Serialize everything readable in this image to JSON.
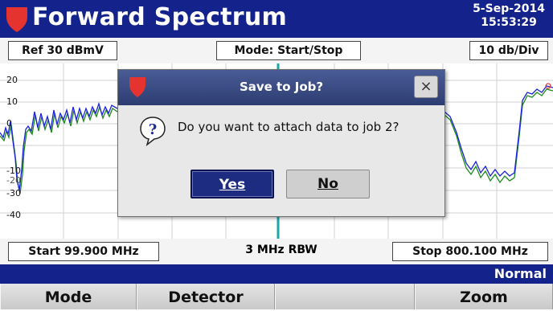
{
  "header": {
    "title": "Forward Spectrum",
    "date": "5-Sep-2014",
    "time": "15:53:29"
  },
  "top_info": {
    "ref": "Ref 30 dBmV",
    "mode": "Mode: Start/Stop",
    "scale": "10 db/Div"
  },
  "plot": {
    "y_ticks": [
      "20",
      "10",
      "0",
      "-10",
      "-20",
      "-30",
      "-40"
    ],
    "trace_colors": {
      "live": "#1a22d8",
      "reference": "#1a8a1a"
    }
  },
  "bottom_info": {
    "start": "Start 99.900 MHz",
    "rbw": "3 MHz RBW",
    "stop": "Stop 800.100 MHz"
  },
  "status": {
    "detector_mode": "Normal"
  },
  "softkeys": [
    "Mode",
    "Detector",
    "",
    "Zoom"
  ],
  "dialog": {
    "title": "Save to Job?",
    "close_label": "×",
    "message": "Do you want to attach data to job 2?",
    "yes_label": "Yes",
    "no_label": "No"
  },
  "colors": {
    "brand_blue": "#14238c",
    "logo_red": "#e5342f",
    "marker_line": "#1aa9a9"
  }
}
